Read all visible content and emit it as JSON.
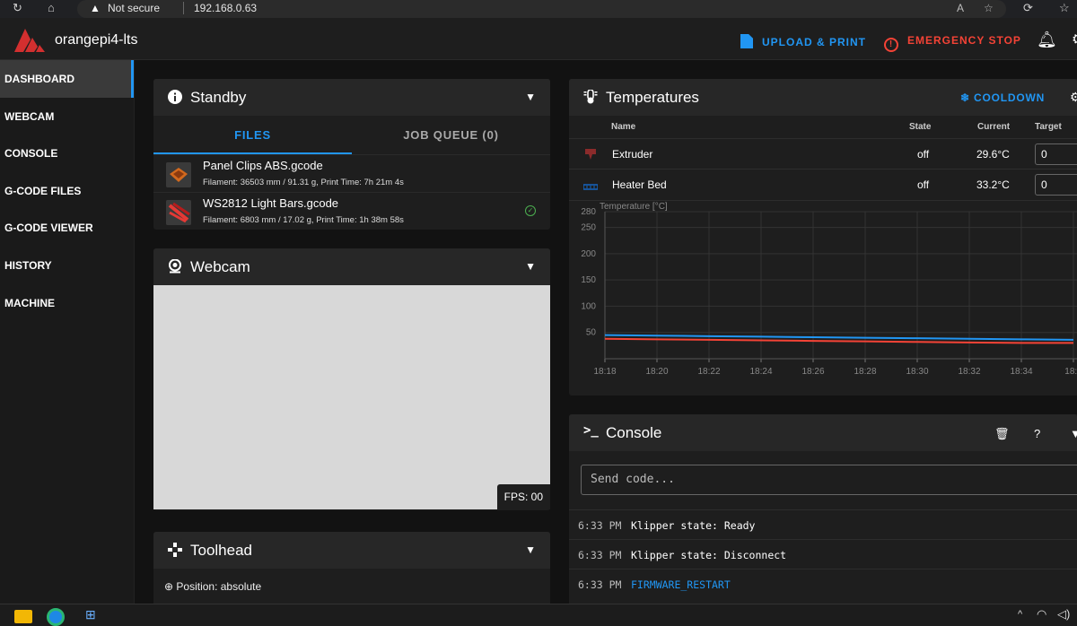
{
  "browser": {
    "reload": "↻",
    "home": "⌂",
    "not_secure": "Not secure",
    "url": "192.168.0.63"
  },
  "app": {
    "title": "orangepi4-lts",
    "upload_label": "UPLOAD & PRINT",
    "estop_label": "EMERGENCY STOP",
    "accent": "#2196f3",
    "danger": "#f44336"
  },
  "sidebar": {
    "items": [
      {
        "label": "DASHBOARD",
        "active": true
      },
      {
        "label": "WEBCAM"
      },
      {
        "label": "CONSOLE"
      },
      {
        "label": "G-CODE FILES"
      },
      {
        "label": "G-CODE VIEWER"
      },
      {
        "label": "HISTORY"
      },
      {
        "label": "MACHINE"
      }
    ]
  },
  "standby": {
    "title": "Standby",
    "tabs": [
      "FILES",
      "JOB QUEUE (0)"
    ],
    "files": [
      {
        "name": "Panel Clips ABS.gcode",
        "meta": "Filament: 36503 mm / 91.31 g, Print Time: 7h 21m 4s"
      },
      {
        "name": "WS2812 Light Bars.gcode",
        "meta": "Filament: 6803 mm / 17.02 g, Print Time: 1h 38m 58s"
      }
    ]
  },
  "webcam": {
    "title": "Webcam",
    "fps": "FPS: 00"
  },
  "toolhead": {
    "title": "Toolhead",
    "position": "Position: absolute"
  },
  "temperatures": {
    "title": "Temperatures",
    "cooldown": "COOLDOWN",
    "headers": {
      "name": "Name",
      "state": "State",
      "current": "Current",
      "target": "Target"
    },
    "rows": [
      {
        "name": "Extruder",
        "state": "off",
        "current": "29.6°C",
        "target": "0"
      },
      {
        "name": "Heater Bed",
        "state": "off",
        "current": "33.2°C",
        "target": "0"
      }
    ]
  },
  "chart_data": {
    "type": "line",
    "ylabel": "Temperature [°C]",
    "ylim": [
      0,
      280
    ],
    "yticks": [
      "280",
      "250",
      "200",
      "150",
      "100",
      "50"
    ],
    "x": [
      "18:18",
      "18:20",
      "18:22",
      "18:24",
      "18:26",
      "18:28",
      "18:30",
      "18:32",
      "18:34",
      "18:3"
    ],
    "series": [
      {
        "color": "#2196f3",
        "values": [
          45,
          44,
          43,
          42,
          41,
          40,
          39,
          38,
          37,
          36
        ]
      },
      {
        "color": "#f44336",
        "values": [
          38,
          37,
          36,
          35,
          34,
          33,
          32,
          31,
          30,
          30
        ]
      }
    ],
    "grid": true
  },
  "console": {
    "title": "Console",
    "placeholder": "Send code...",
    "entries": [
      {
        "time": "6:33 PM",
        "msg": "Klipper state: Ready"
      },
      {
        "time": "6:33 PM",
        "msg": "Klipper state: Disconnect"
      },
      {
        "time": "6:33 PM",
        "msg": "FIRMWARE_RESTART",
        "link": true
      }
    ]
  }
}
